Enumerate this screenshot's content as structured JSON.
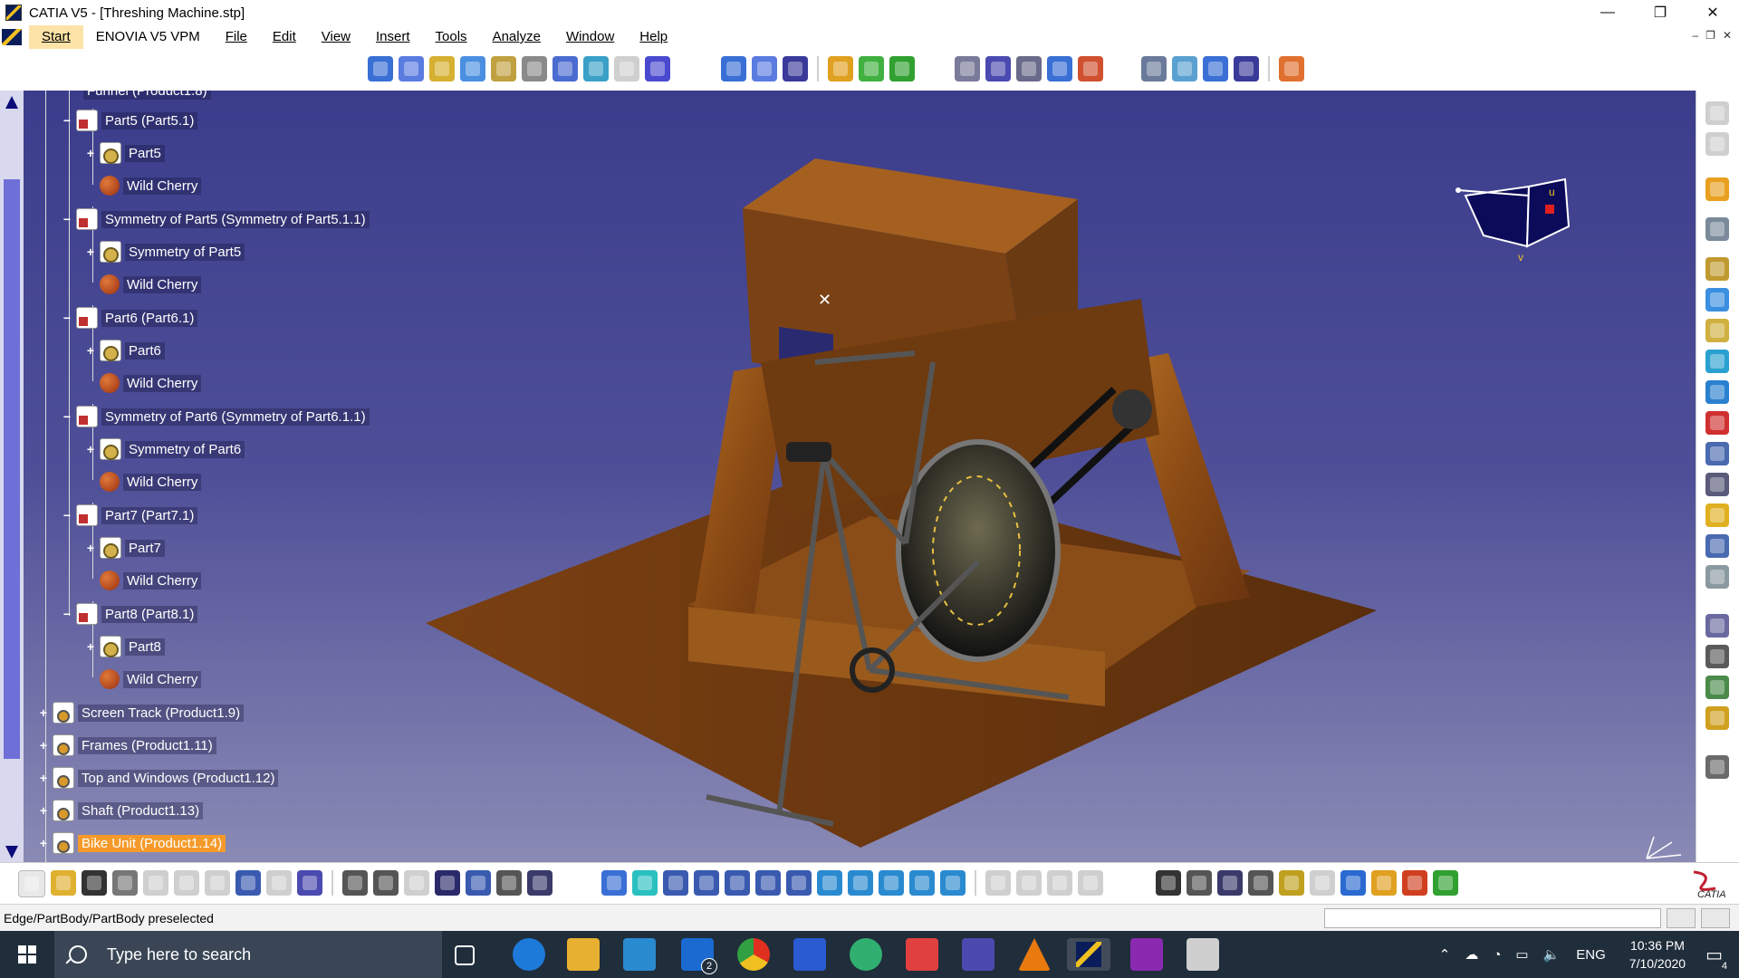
{
  "window": {
    "title": "CATIA V5 - [Threshing Machine.stp]",
    "minimize_glyph": "—",
    "restore_glyph": "❐",
    "close_glyph": "✕"
  },
  "menubar": {
    "items": [
      "Start",
      "ENOVIA V5 VPM",
      "File",
      "Edit",
      "View",
      "Insert",
      "Tools",
      "Analyze",
      "Window",
      "Help"
    ]
  },
  "tree": {
    "cut_off_top": "Funnel (Product1.8)",
    "nodes": [
      {
        "label": "Part5 (Part5.1)",
        "kind": "partinst"
      },
      {
        "label": "Part5",
        "kind": "part"
      },
      {
        "label": "Wild Cherry",
        "kind": "material"
      },
      {
        "label": "Symmetry of Part5 (Symmetry of Part5.1.1)",
        "kind": "partinst"
      },
      {
        "label": "Symmetry of Part5",
        "kind": "part"
      },
      {
        "label": "Wild Cherry",
        "kind": "material"
      },
      {
        "label": "Part6 (Part6.1)",
        "kind": "partinst"
      },
      {
        "label": "Part6",
        "kind": "part"
      },
      {
        "label": "Wild Cherry",
        "kind": "material"
      },
      {
        "label": "Symmetry of Part6 (Symmetry of Part6.1.1)",
        "kind": "partinst"
      },
      {
        "label": "Symmetry of Part6",
        "kind": "part"
      },
      {
        "label": "Wild Cherry",
        "kind": "material"
      },
      {
        "label": "Part7 (Part7.1)",
        "kind": "partinst"
      },
      {
        "label": "Part7",
        "kind": "part"
      },
      {
        "label": "Wild Cherry",
        "kind": "material"
      },
      {
        "label": "Part8 (Part8.1)",
        "kind": "partinst"
      },
      {
        "label": "Part8",
        "kind": "part"
      },
      {
        "label": "Wild Cherry",
        "kind": "material"
      },
      {
        "label": "Screen Track (Product1.9)",
        "kind": "product"
      },
      {
        "label": "Frames (Product1.11)",
        "kind": "product"
      },
      {
        "label": "Top and Windows (Product1.12)",
        "kind": "product"
      },
      {
        "label": "Shaft (Product1.13)",
        "kind": "product"
      },
      {
        "label": "Bike Unit (Product1.14)",
        "kind": "product",
        "selected": true
      }
    ]
  },
  "compass": {
    "u_label": "u",
    "v_label": "v"
  },
  "status": {
    "message": "Edge/PartBody/PartBody preselected"
  },
  "catia_logo_text": "CATIA",
  "taskbar": {
    "search_placeholder": "Type here to search",
    "language": "ENG",
    "time": "10:36 PM",
    "date": "7/10/2020",
    "mail_badge": "2",
    "notification_count": "4"
  },
  "colors": {
    "viewport_top": "#3b3d8c",
    "viewport_bottom": "#8a8ab5",
    "selection": "#f59a2a",
    "wood": "#9a5a1c"
  }
}
